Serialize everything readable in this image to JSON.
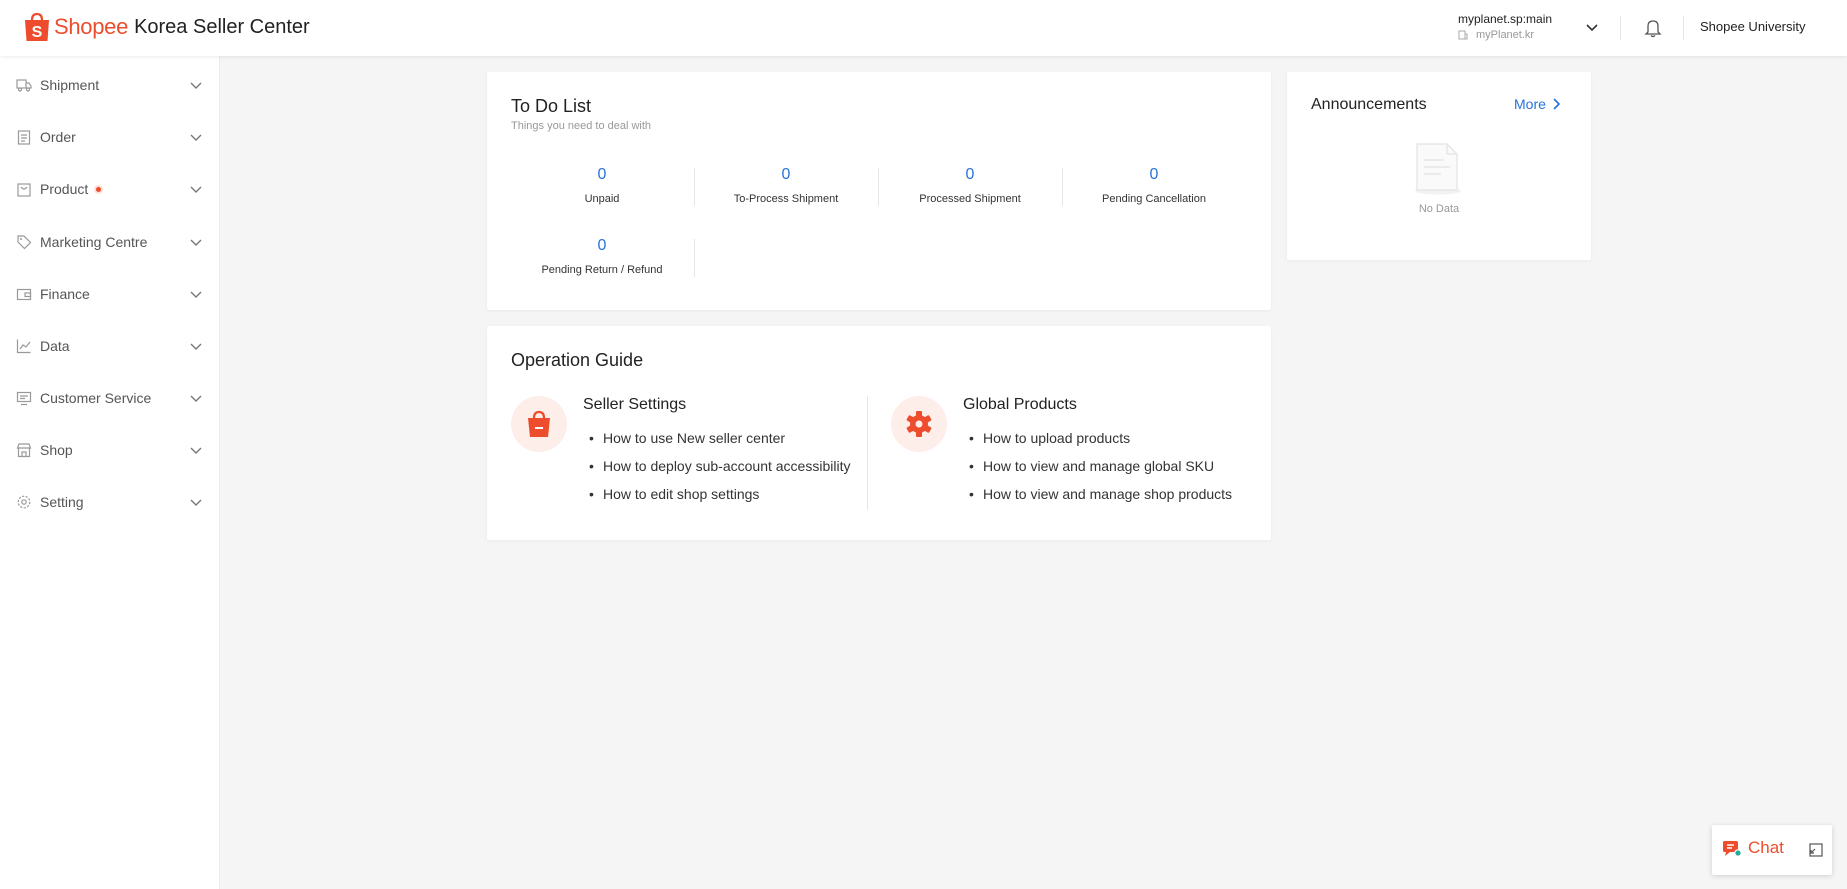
{
  "header": {
    "brand": "Shopee",
    "subtitle": "Korea Seller Center",
    "account_name": "myplanet.sp:main",
    "account_shop": "myPlanet.kr",
    "university_link": "Shopee University"
  },
  "sidebar": {
    "items": [
      {
        "label": "Shipment",
        "icon": "truck-icon"
      },
      {
        "label": "Order",
        "icon": "clipboard-icon"
      },
      {
        "label": "Product",
        "icon": "bag-icon"
      },
      {
        "label": "Marketing Centre",
        "icon": "tag-icon"
      },
      {
        "label": "Finance",
        "icon": "wallet-icon"
      },
      {
        "label": "Data",
        "icon": "chart-icon"
      },
      {
        "label": "Customer Service",
        "icon": "monitor-icon"
      },
      {
        "label": "Shop",
        "icon": "store-icon"
      },
      {
        "label": "Setting",
        "icon": "gear-icon"
      }
    ]
  },
  "todo": {
    "title": "To Do List",
    "subtitle": "Things you need to deal with",
    "stats": [
      {
        "value": "0",
        "label": "Unpaid"
      },
      {
        "value": "0",
        "label": "To-Process Shipment"
      },
      {
        "value": "0",
        "label": "Processed Shipment"
      },
      {
        "value": "0",
        "label": "Pending Cancellation"
      },
      {
        "value": "0",
        "label": "Pending Return / Refund"
      }
    ]
  },
  "guide": {
    "title": "Operation Guide",
    "sections": [
      {
        "heading": "Seller Settings",
        "links": [
          "How to use New seller center",
          "How to deploy sub-account accessibility",
          "How to edit shop settings"
        ]
      },
      {
        "heading": "Global Products",
        "links": [
          "How to upload products",
          "How to view and manage global SKU",
          "How to view and manage shop products"
        ]
      }
    ]
  },
  "announcements": {
    "title": "Announcements",
    "more_label": "More",
    "empty_text": "No Data"
  },
  "chat": {
    "label": "Chat"
  },
  "colors": {
    "brand": "#ee4d2d",
    "link": "#2673dd"
  }
}
